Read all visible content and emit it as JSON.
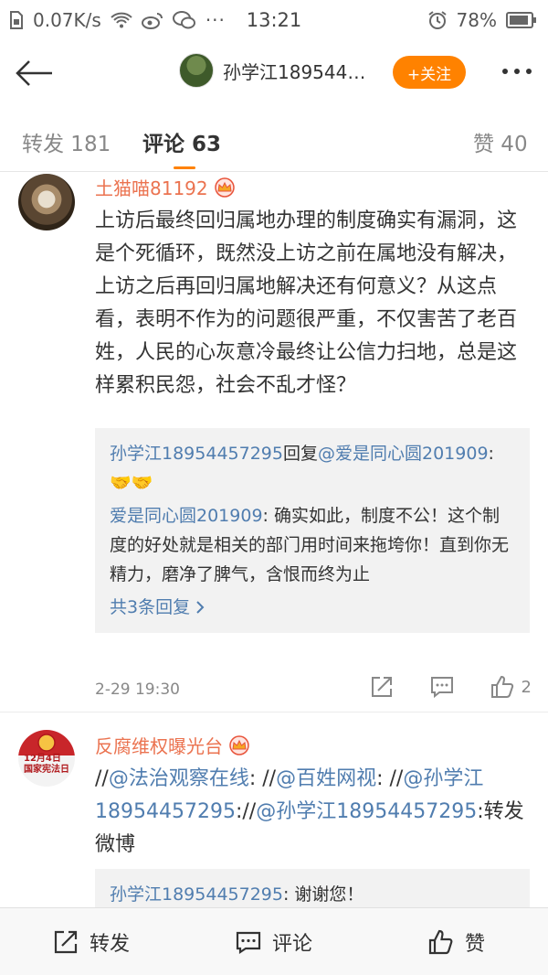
{
  "status": {
    "speed": "0.07K/s",
    "time": "13:21",
    "battery": "78%"
  },
  "nav": {
    "name": "孙学江189544…",
    "follow": "+关注"
  },
  "tabs": [
    {
      "label": "转发 181",
      "active": false
    },
    {
      "label": "评论 63",
      "active": true
    },
    {
      "label": "赞 40",
      "active": false
    }
  ],
  "comments": [
    {
      "name": "土猫喵81192",
      "text": "上访后最终回归属地办理的制度确实有漏洞，这是个死循环，既然没上访之前在属地没有解决，上访之后再回归属地解决还有何意义？从这点看，表明不作为的问题很严重，不仅害苦了老百姓，人民的心灰意冷最终让公信力扫地，总是这样累积民怨，社会不乱才怪？",
      "reply1_user": "孙学江18954457295",
      "reply1_mid": "回复",
      "reply1_target": "@爱是同心圆201909",
      "reply1_tail": ":🤝🤝",
      "reply2_user": "爱是同心圆201909",
      "reply2_text": ": 确实如此，制度不公！这个制度的好处就是相关的部门用时间来拖垮你！直到你无精力，磨净了脾气，含恨而终为止",
      "more": "共3条回复",
      "time": "2-29 19:30",
      "likes": "2"
    },
    {
      "name": "反腐维权曝光台",
      "avatar_text": "12月4日国家宪法日",
      "p1": "//",
      "l1": "@法治观察在线",
      "p2": ": //",
      "l2": "@百姓网视",
      "p3": ": //",
      "l3": "@孙学江18954457295",
      "p4": "://",
      "l4": "@孙学江18954457295",
      "p5": ":转发微博",
      "reply_user": "孙学江18954457295",
      "reply_text": ": 谢谢您！"
    }
  ],
  "toolbar": {
    "repost": "转发",
    "comment": "评论",
    "like": "赞"
  },
  "colors": {
    "accent": "#ff8200",
    "username": "#eb7350",
    "link": "#507daf"
  }
}
